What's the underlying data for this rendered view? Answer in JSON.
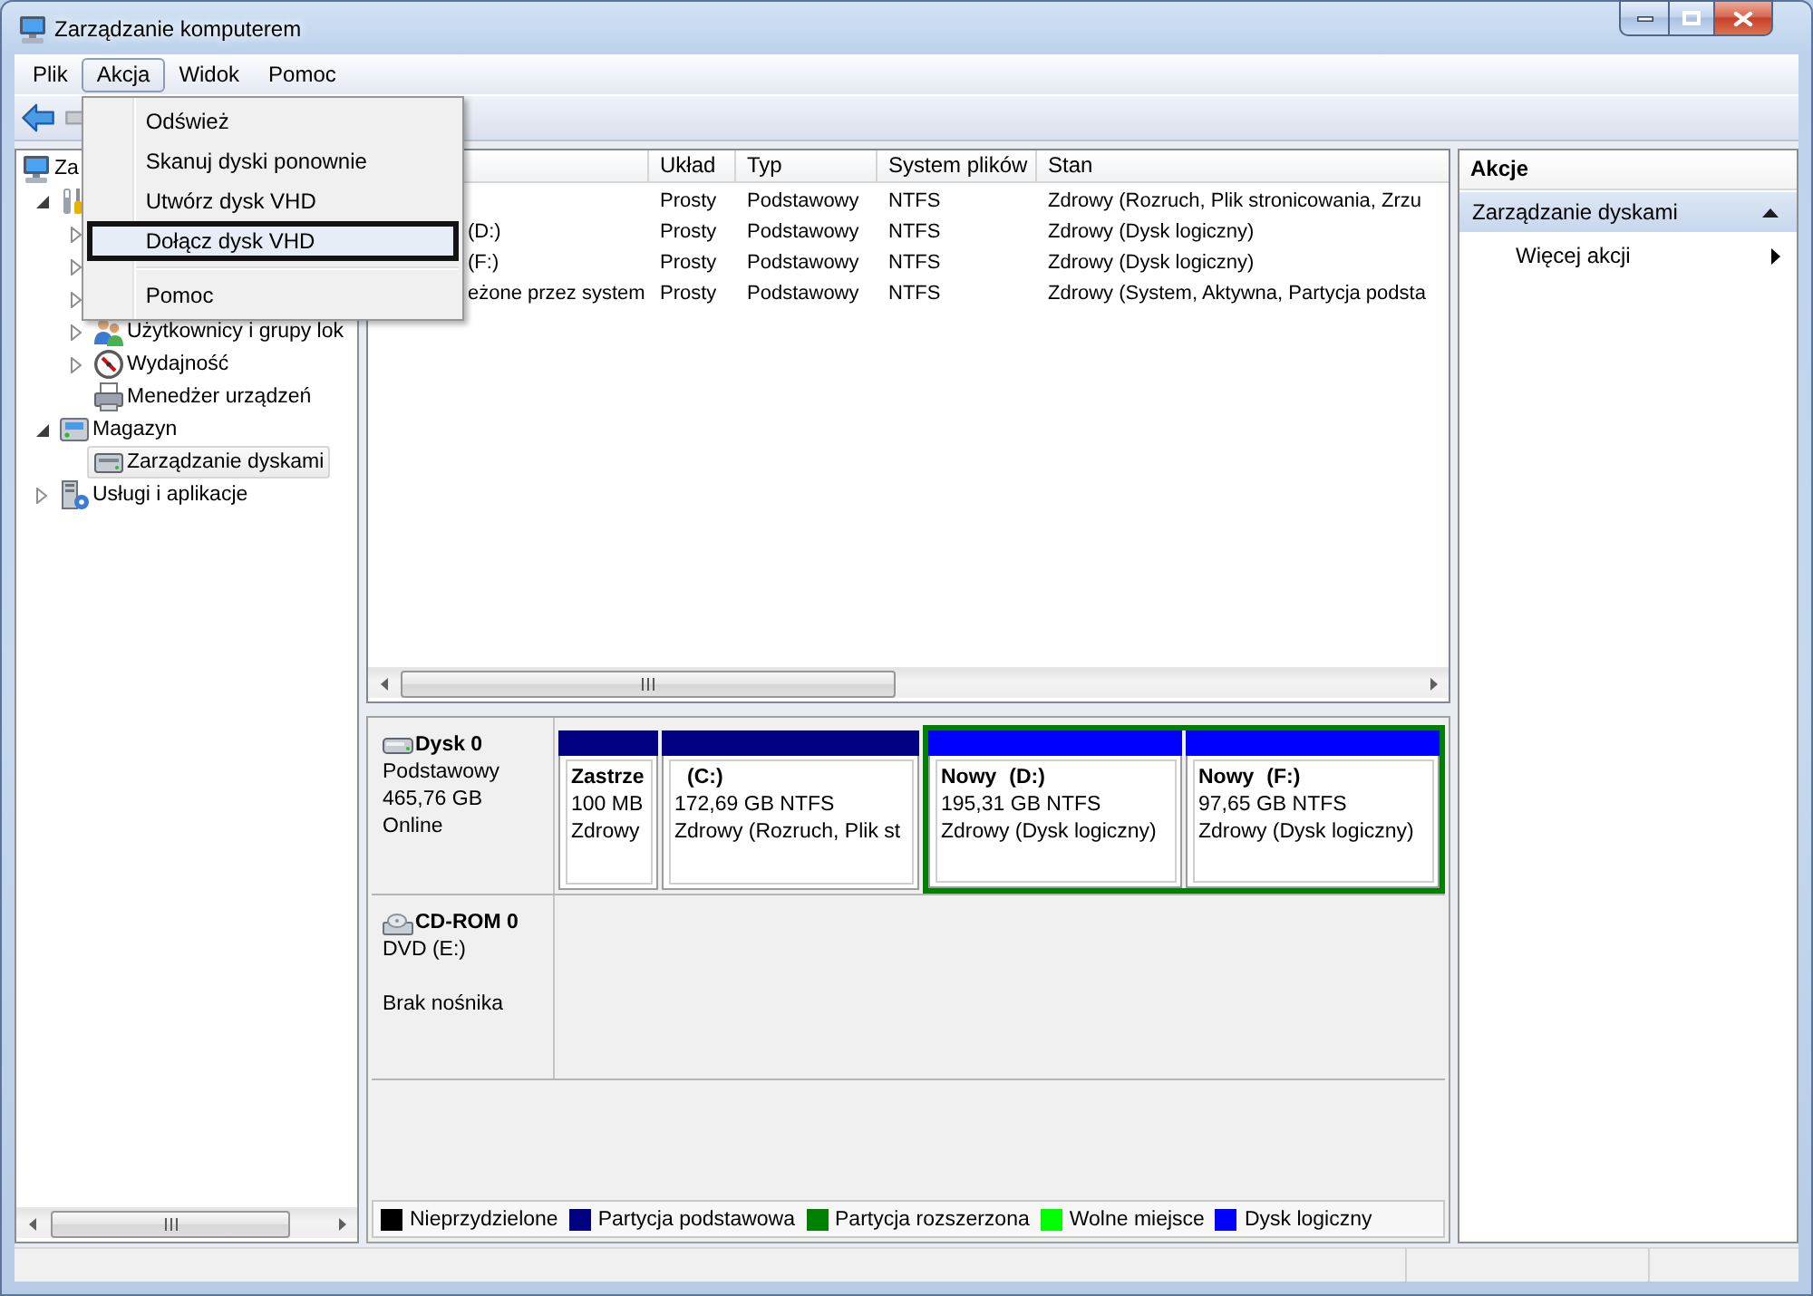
{
  "window": {
    "title": "Zarządzanie komputerem"
  },
  "menu_bar": [
    {
      "label": "Plik",
      "selected": false
    },
    {
      "label": "Akcja",
      "selected": true,
      "menu": [
        [
          {
            "label": "Odśwież",
            "selected": false
          },
          {
            "label": "Skanuj dyski ponownie",
            "selected": false
          },
          {
            "label": "Utwórz dysk VHD",
            "selected": false
          },
          {
            "label": "Dołącz dysk VHD",
            "selected": true
          }
        ],
        [
          {
            "label": "Pomoc",
            "selected": false
          }
        ]
      ]
    },
    {
      "label": "Widok",
      "selected": false
    },
    {
      "label": "Pomoc",
      "selected": false
    }
  ],
  "toolbar": [
    {
      "kind": "back",
      "disabled": false
    },
    {
      "kind": "forward",
      "disabled": true
    }
  ],
  "tree": [
    {
      "label": "Za",
      "kind": "computer",
      "selected": false,
      "children": [
        {
          "kind": "tools",
          "expanded": true,
          "selected": false,
          "children": [
            {
              "expanded": false
            },
            {
              "expanded": false
            },
            {
              "expanded": false
            },
            {
              "label": "Użytkownicy i grupy lok",
              "kind": "users",
              "expanded": false,
              "selected": false
            },
            {
              "label": "Wydajność",
              "kind": "performance",
              "expanded": false,
              "selected": false
            },
            {
              "label": "Menedżer urządzeń",
              "kind": "device-manager",
              "selected": false
            }
          ]
        },
        {
          "label": "Magazyn",
          "kind": "storage",
          "expanded": true,
          "selected": false,
          "children": [
            {
              "label": "Zarządzanie dyskami",
              "kind": "disk-management",
              "selected": true
            }
          ]
        },
        {
          "label": "Usługi i aplikacje",
          "kind": "services",
          "expanded": false,
          "selected": false
        }
      ]
    }
  ],
  "volume_list": {
    "headers": {
      "layout": "Układ",
      "type": "Typ",
      "file_system": "System plików",
      "status": "Stan"
    },
    "rows": [
      {
        "layout": "Prosty",
        "type": "Podstawowy",
        "file_system": "NTFS",
        "status": "Zdrowy (Rozruch, Plik stronicowania, Zrzu"
      },
      {
        "column_1": "(D:)",
        "layout": "Prosty",
        "type": "Podstawowy",
        "file_system": "NTFS",
        "status": "Zdrowy (Dysk logiczny)"
      },
      {
        "column_1": "(F:)",
        "layout": "Prosty",
        "type": "Podstawowy",
        "file_system": "NTFS",
        "status": "Zdrowy (Dysk logiczny)"
      },
      {
        "column_1": "eżone przez system",
        "layout": "Prosty",
        "type": "Podstawowy",
        "file_system": "NTFS",
        "status": "Zdrowy (System, Aktywna, Partycja podsta"
      }
    ]
  },
  "disks": [
    {
      "kind": "hdd",
      "name": "Dysk 0",
      "type": "Podstawowy",
      "size": "465,76 GB",
      "status": "Online",
      "partitions": [
        {
          "kind": "primary",
          "name": "Zastrze",
          "details": "100 MB",
          "status": "Zdrowy"
        },
        {
          "kind": "primary",
          "drive": "(C:)",
          "details": "172,69 GB NTFS",
          "status": "Zdrowy (Rozruch, Plik st"
        },
        {
          "kind": "extended",
          "partitions": [
            {
              "kind": "logical",
              "name": "Nowy",
              "drive": "(D:)",
              "details": "195,31 GB NTFS",
              "status": "Zdrowy (Dysk logiczny)"
            },
            {
              "kind": "logical",
              "name": "Nowy",
              "drive": "(F:)",
              "details": "97,65 GB NTFS",
              "status": "Zdrowy (Dysk logiczny)"
            }
          ]
        }
      ]
    },
    {
      "kind": "cdrom",
      "name": "CD-ROM 0",
      "type": "DVD (E:)",
      "status": "Brak nośnika"
    }
  ],
  "legend": [
    {
      "kind": "unallocated",
      "label": "Nieprzydzielone",
      "color": "#000000"
    },
    {
      "kind": "primary",
      "label": "Partycja podstawowa",
      "color": "#000080"
    },
    {
      "kind": "extended",
      "label": "Partycja rozszerzona",
      "color": "#008000"
    },
    {
      "kind": "free",
      "label": "Wolne miejsce",
      "color": "#00ff00"
    },
    {
      "kind": "logical",
      "label": "Dysk logiczny",
      "color": "#0000ff"
    }
  ],
  "actions": {
    "title": "Akcje",
    "sections": [
      {
        "label": "Zarządzanie dyskami",
        "expanded": true,
        "items": [
          {
            "label": "Więcej akcji",
            "submenu": true
          }
        ]
      }
    ]
  }
}
